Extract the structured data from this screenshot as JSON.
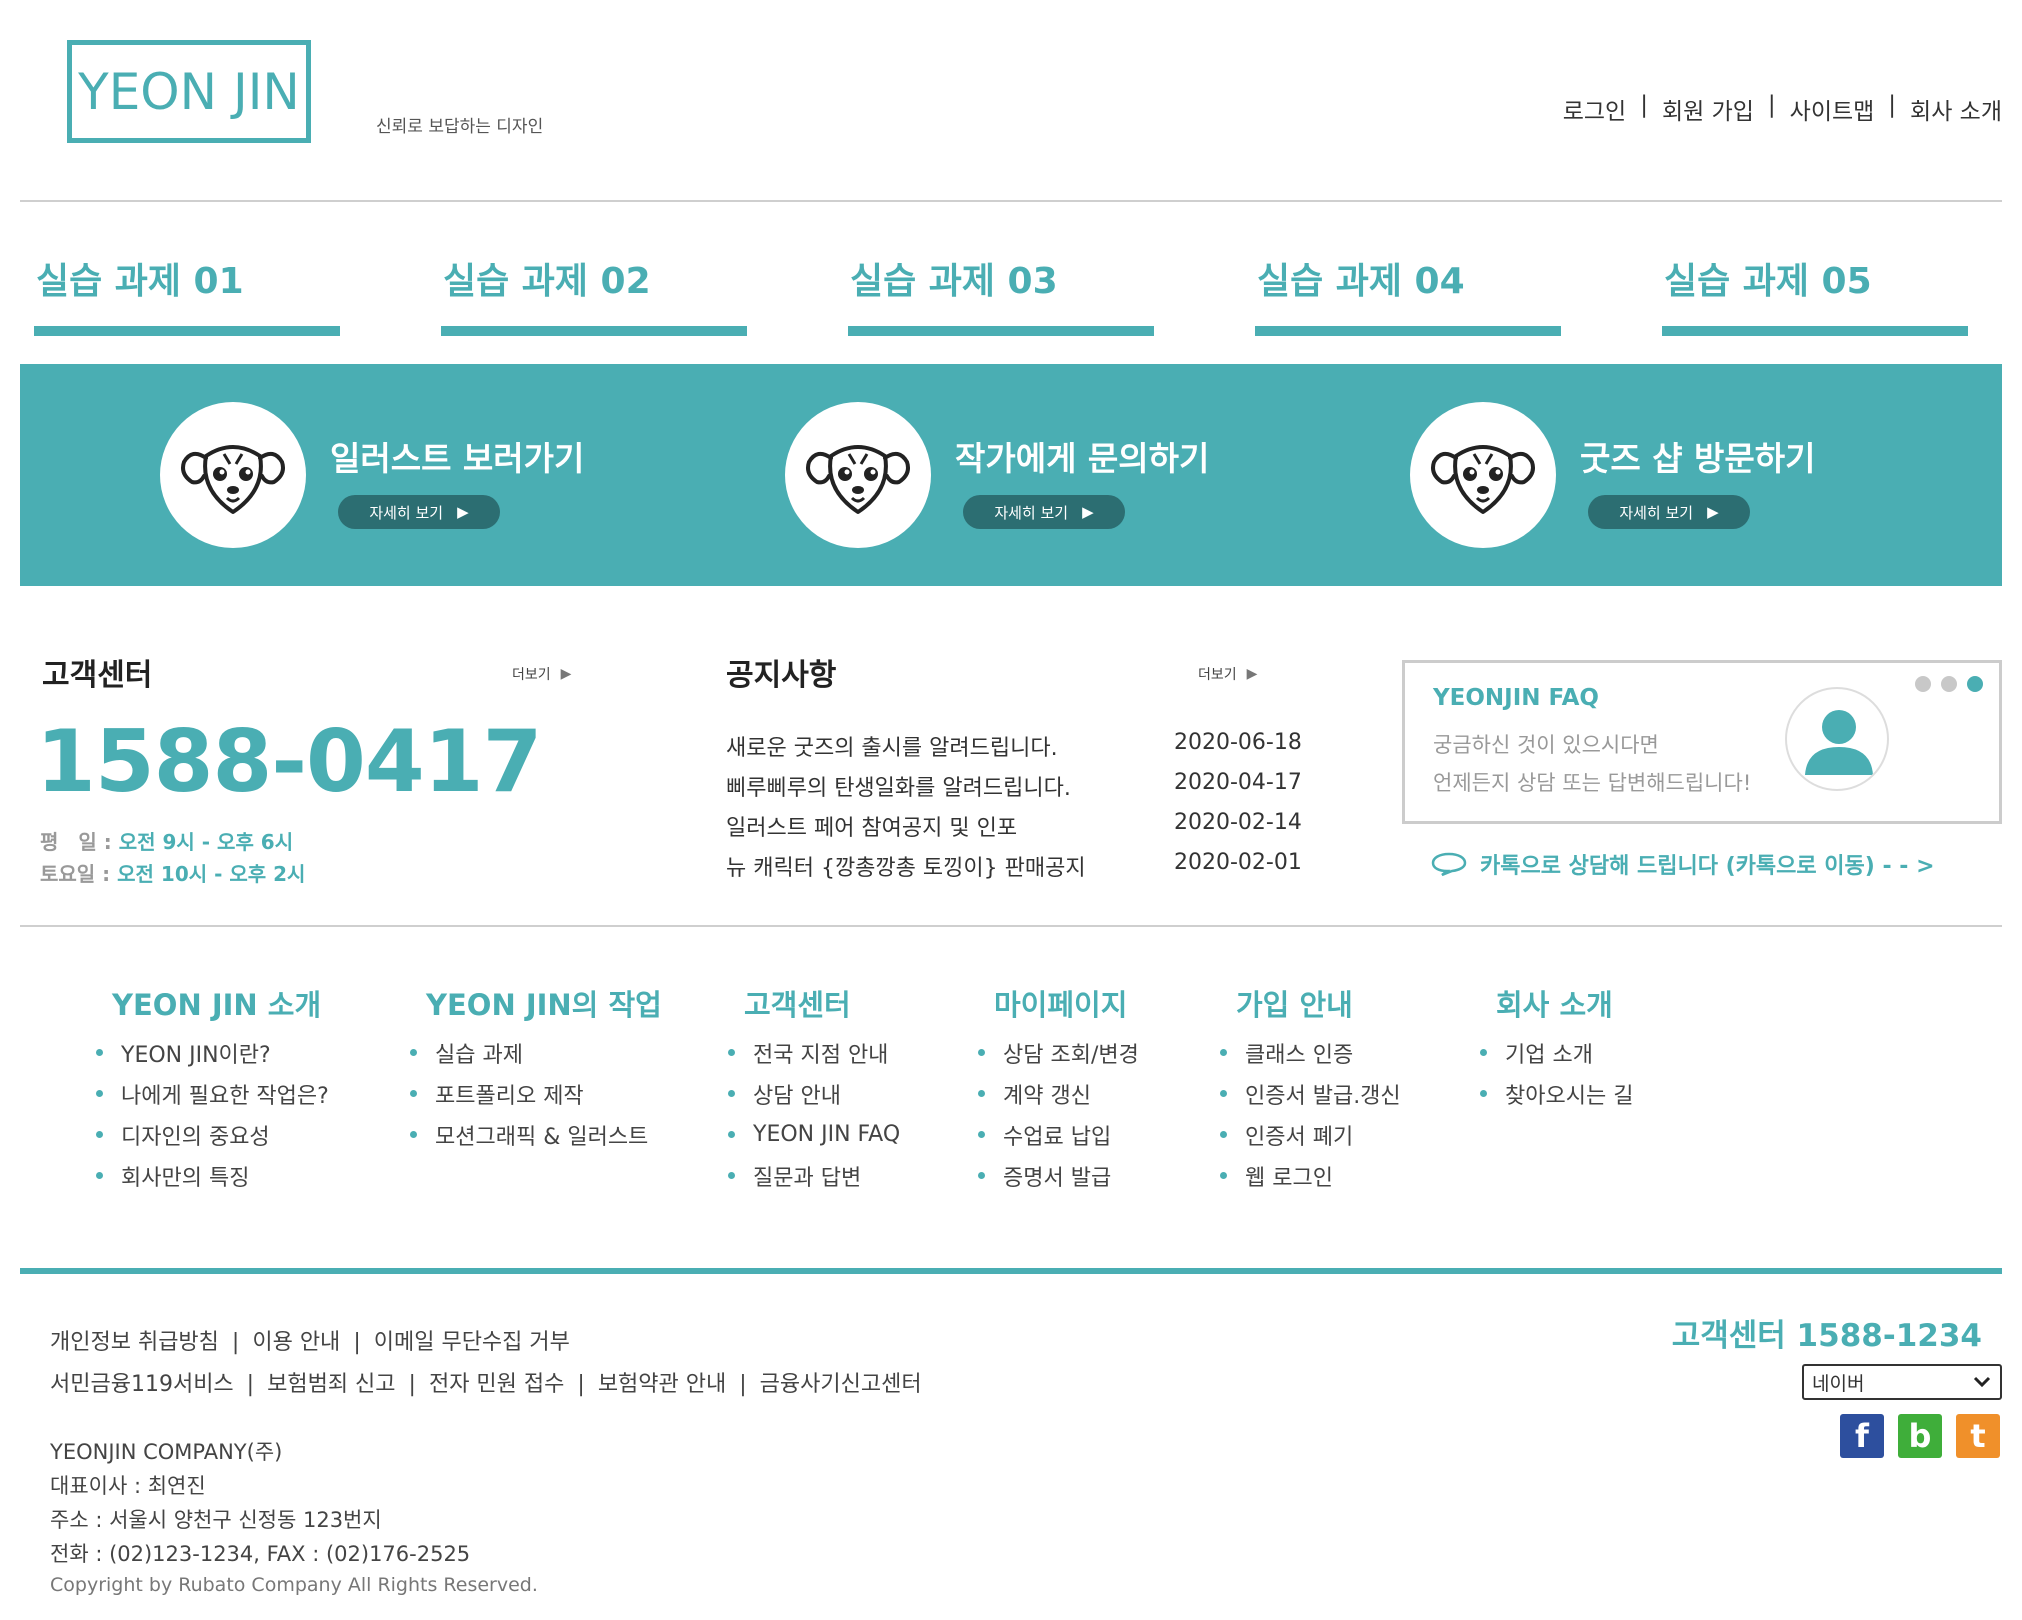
{
  "header": {
    "logo": "YEON JIN",
    "tagline": "신뢰로 보답하는 디자인",
    "links": [
      "로그인",
      "회원 가입",
      "사이트맵",
      "회사 소개"
    ]
  },
  "tabs": [
    "실습 과제 01",
    "실습 과제 02",
    "실습 과제 03",
    "실습 과제 04",
    "실습 과제 05"
  ],
  "banner": {
    "promos": [
      {
        "title": "일러스트 보러가기",
        "button": "자세히 보기"
      },
      {
        "title": "작가에게 문의하기",
        "button": "자세히 보기"
      },
      {
        "title": "굿즈 샵 방문하기",
        "button": "자세히 보기"
      }
    ]
  },
  "customer_center": {
    "title": "고객센터",
    "more": "더보기",
    "phone": "1588-0417",
    "weekday_label": "평　일 :",
    "weekday_hours": "오전  9시 - 오후 6시",
    "saturday_label": "토요일 :",
    "saturday_hours": "오전 10시 - 오후 2시"
  },
  "notices": {
    "title": "공지사항",
    "more": "더보기",
    "items": [
      {
        "title": "새로운 굿즈의 출시를 알려드립니다.",
        "date": "2020-06-18"
      },
      {
        "title": "삐루삐루의 탄생일화를 알려드립니다.",
        "date": "2020-04-17"
      },
      {
        "title": "일러스트 페어 참여공지 및 인포",
        "date": "2020-02-14"
      },
      {
        "title": "뉴 캐릭터 {깡총깡총 토낑이} 판매공지",
        "date": "2020-02-01"
      }
    ]
  },
  "faq": {
    "title": "YEONJIN FAQ",
    "line1": "궁금하신 것이 있으시다면",
    "line2": "언제든지 상담 또는 답변해드립니다!",
    "kakao": "카톡으로 상담해 드립니다 (카톡으로 이동) - - >"
  },
  "sitemap": [
    {
      "title": "YEON JIN 소개",
      "items": [
        "YEON JIN이란?",
        "나에게 필요한 작업은?",
        "디자인의 중요성",
        "회사만의 특징"
      ]
    },
    {
      "title": "YEON JIN의 작업",
      "items": [
        "실습 과제",
        "포트폴리오 제작",
        "모션그래픽 & 일러스트"
      ]
    },
    {
      "title": "고객센터",
      "items": [
        "전국 지점 안내",
        "상담 안내",
        "YEON JIN FAQ",
        "질문과 답변"
      ]
    },
    {
      "title": "마이페이지",
      "items": [
        "상담 조회/변경",
        "계약 갱신",
        "수업료 납입",
        "증명서 발급"
      ]
    },
    {
      "title": "가입 안내",
      "items": [
        "클래스 인증",
        "인증서 발급.갱신",
        "인증서 폐기",
        "웹 로그인"
      ]
    },
    {
      "title": "회사 소개",
      "items": [
        "기업 소개",
        "찾아오시는 길"
      ]
    }
  ],
  "footer": {
    "links_row1": [
      "개인정보 취급방침",
      "이용 안내",
      "이메일 무단수집 거부"
    ],
    "links_row2": [
      "서민금융119서비스",
      "보험범죄 신고",
      "전자 민원 접수",
      "보험약관 안내",
      "금융사기신고센터"
    ],
    "cs": "고객센터 1588-1234",
    "portal_selected": "네이버",
    "sns": [
      {
        "icon": "facebook-icon",
        "letter": "f",
        "color": "#2d4f9e"
      },
      {
        "icon": "blog-icon",
        "letter": "b",
        "color": "#3fae3a"
      },
      {
        "icon": "tumblr-icon",
        "letter": "t",
        "color": "#f0902a"
      }
    ],
    "company": "YEONJIN COMPANY(주)",
    "ceo": "대표이사 : 최연진",
    "address": "주소 : 서울시 양천구 신정동 123번지",
    "contact": "전화 : (02)123-1234, FAX : (02)176-2525",
    "copyright": "Copyright by Rubato Company All Rights Reserved."
  },
  "colors": {
    "accent": "#4aaeb3",
    "button_dark": "#2c6e72"
  }
}
